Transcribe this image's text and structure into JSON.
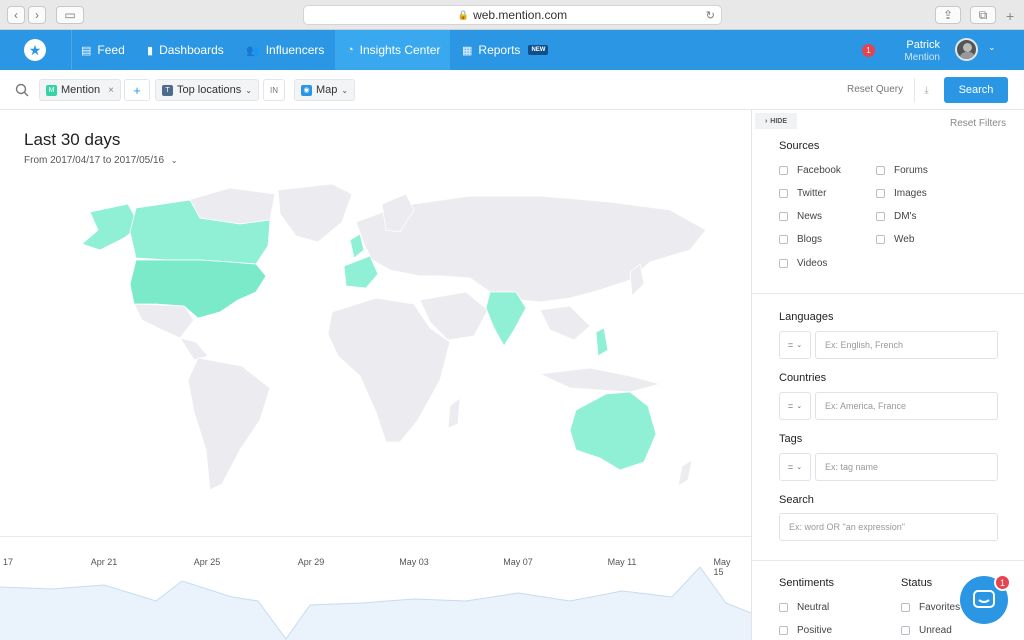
{
  "browser": {
    "url": "web.mention.com"
  },
  "nav": {
    "items": [
      {
        "label": "Feed",
        "icon": "feed-icon"
      },
      {
        "label": "Dashboards",
        "icon": "bar-chart-icon"
      },
      {
        "label": "Influencers",
        "icon": "users-icon"
      },
      {
        "label": "Insights Center",
        "icon": "insights-icon",
        "active": true
      },
      {
        "label": "Reports",
        "icon": "grid-icon",
        "badge": "NEW"
      }
    ],
    "notifications": "1",
    "user": {
      "name": "Patrick",
      "org": "Mention"
    }
  },
  "query": {
    "alert_chip": "Mention",
    "alert_chip_letter": "M",
    "add_label": "+",
    "metric_chip": "Top locations",
    "metric_chip_letter": "T",
    "in_label": "IN",
    "view_chip": "Map",
    "reset_label": "Reset Query",
    "search_label": "Search"
  },
  "main": {
    "title": "Last 30 days",
    "range": "From 2017/04/17 to 2017/05/16",
    "timeline_ticks": [
      "17",
      "Apr 21",
      "Apr 25",
      "Apr 29",
      "May 03",
      "May 07",
      "May 11",
      "May 15"
    ]
  },
  "panel": {
    "hide_label": "HIDE",
    "reset_filters": "Reset Filters",
    "sources_title": "Sources",
    "sources_col1": [
      "Facebook",
      "Twitter",
      "News",
      "Blogs",
      "Videos"
    ],
    "sources_col2": [
      "Forums",
      "Images",
      "DM's",
      "Web"
    ],
    "languages_title": "Languages",
    "languages_placeholder": "Ex: English, French",
    "countries_title": "Countries",
    "countries_placeholder": "Ex: America, France",
    "tags_title": "Tags",
    "tags_placeholder": "Ex: tag name",
    "search_title": "Search",
    "search_placeholder": "Ex: word OR \"an expression\"",
    "operator": "=",
    "sentiments_title": "Sentiments",
    "sentiments": [
      "Neutral",
      "Positive"
    ],
    "status_title": "Status",
    "status": [
      "Favorites",
      "Unread"
    ]
  },
  "chat": {
    "badge": "1"
  },
  "colors": {
    "accent": "#2b97e4",
    "map_highlight": "#8ff0d6",
    "map_strong": "#7beac8",
    "map_base": "#ececf0"
  }
}
